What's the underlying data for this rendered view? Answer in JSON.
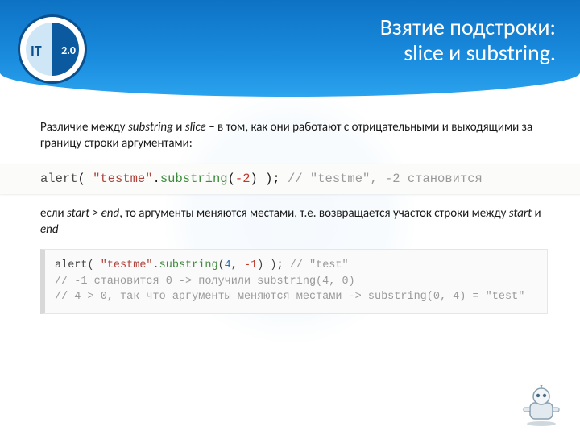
{
  "logo": {
    "it": "IT",
    "version": "2.0"
  },
  "title": {
    "line1": "Взятие подстроки:",
    "line2": "slice и substring."
  },
  "para1": {
    "pre": "Различие между ",
    "em1": "substring",
    "mid": " и ",
    "em2": "slice",
    "post": " – в том, как они работают с отрицательными и выходящими за границу строки аргументами:"
  },
  "code1": {
    "alert": "alert",
    "paren_open": "( ",
    "str": "\"testme\"",
    "dot": ".",
    "method": "substring",
    "args_open": "(",
    "arg_neg2": "-2",
    "args_close": ")",
    "paren_close": " );",
    "comment": " // \"testme\", -2 становится"
  },
  "para2": {
    "pre": "если ",
    "em1": "start > end",
    "mid": ", то аргументы меняются местами, т.е. возвращается участок строки между ",
    "em2": "start",
    "mid2": " и ",
    "em3": "end"
  },
  "code2": {
    "l1_alert": "alert",
    "l1_po": "( ",
    "l1_str": "\"testme\"",
    "l1_dot": ".",
    "l1_meth": "substring",
    "l1_ao": "(",
    "l1_a1": "4",
    "l1_c": ", ",
    "l1_a2": "-1",
    "l1_ac": ")",
    "l1_pc": " ); ",
    "l1_cmt": "// \"test\"",
    "l2": "// -1 становится 0 -> получили substring(4, 0)",
    "l3": "// 4 > 0, так что аргументы меняются местами -> substring(0, 4) = \"test\""
  }
}
